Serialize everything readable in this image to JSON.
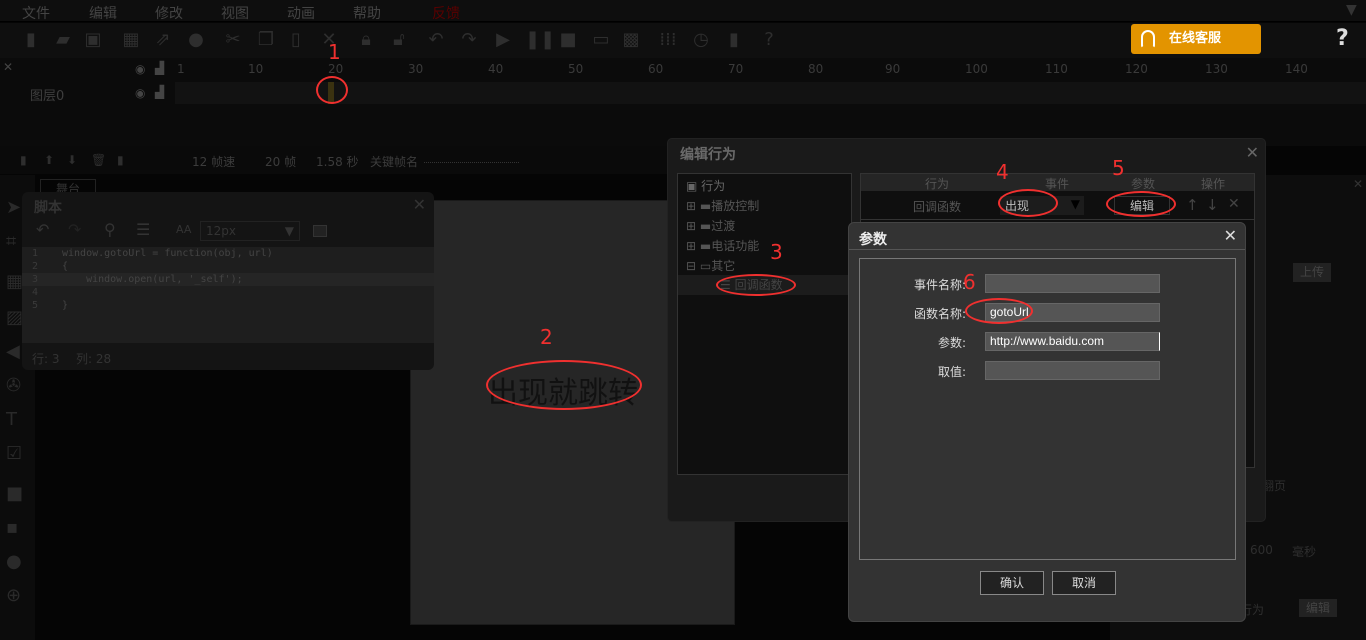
{
  "menu": [
    "文件",
    "编辑",
    "修改",
    "视图",
    "动画",
    "帮助",
    "反馈"
  ],
  "service_button": "在线客服",
  "timeline": {
    "ruler": [
      "1",
      "10",
      "20",
      "30",
      "40",
      "50",
      "60",
      "70",
      "80",
      "90",
      "100",
      "110",
      "120",
      "130",
      "140"
    ],
    "layer_name": "图层0",
    "fps": "12 帧速",
    "frame": "20 帧",
    "time": "1.58 秒",
    "keyframe_label": "关键帧名"
  },
  "stage_tab": "舞台",
  "stage_text": "出现就跳转",
  "script": {
    "title": "脚本",
    "font_size": "12px",
    "lines": [
      "window.gotoUrl = function(obj, url)",
      "{",
      "    window.open(url, '_self');",
      "",
      "}"
    ],
    "status_row": "行: 3",
    "status_col": "列: 28"
  },
  "behavior": {
    "title": "编辑行为",
    "tree": {
      "root": "行为",
      "folders": [
        "播放控制",
        "过渡",
        "电话功能",
        "其它"
      ],
      "leaf": "回调函数"
    },
    "columns": [
      "行为",
      "事件",
      "参数",
      "操作"
    ],
    "row": {
      "behavior": "回调函数",
      "event": "出现",
      "param": "编辑"
    }
  },
  "params": {
    "title": "参数",
    "fields": [
      {
        "label": "事件名称:",
        "value": ""
      },
      {
        "label": "函数名称:",
        "value": "gotoUrl"
      },
      {
        "label": "参数:",
        "value": "http://www.baidu.com"
      },
      {
        "label": "取值:",
        "value": ""
      }
    ],
    "ok": "确认",
    "cancel": "取消"
  },
  "right_panel": {
    "upload": "上传",
    "page_turn": "不翻页",
    "duration": "600",
    "ms": "毫秒",
    "behavior_select": "行为",
    "edit": "编辑"
  },
  "annotations": [
    "1",
    "2",
    "3",
    "4",
    "5",
    "6"
  ],
  "colors": {
    "accent": "#e39400",
    "annotation": "#f0302f"
  }
}
